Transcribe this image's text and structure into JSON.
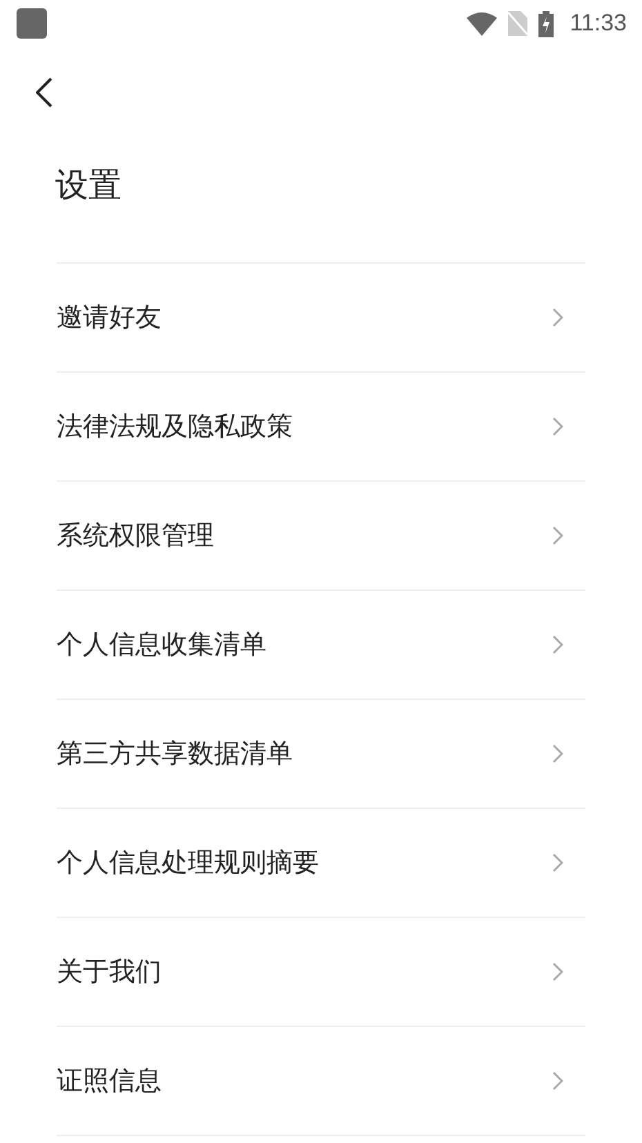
{
  "status_bar": {
    "time": "11:33"
  },
  "title": "设置",
  "items": [
    {
      "label": "邀请好友"
    },
    {
      "label": "法律法规及隐私政策"
    },
    {
      "label": "系统权限管理"
    },
    {
      "label": "个人信息收集清单"
    },
    {
      "label": "第三方共享数据清单"
    },
    {
      "label": "个人信息处理规则摘要"
    },
    {
      "label": "关于我们"
    },
    {
      "label": "证照信息"
    }
  ]
}
